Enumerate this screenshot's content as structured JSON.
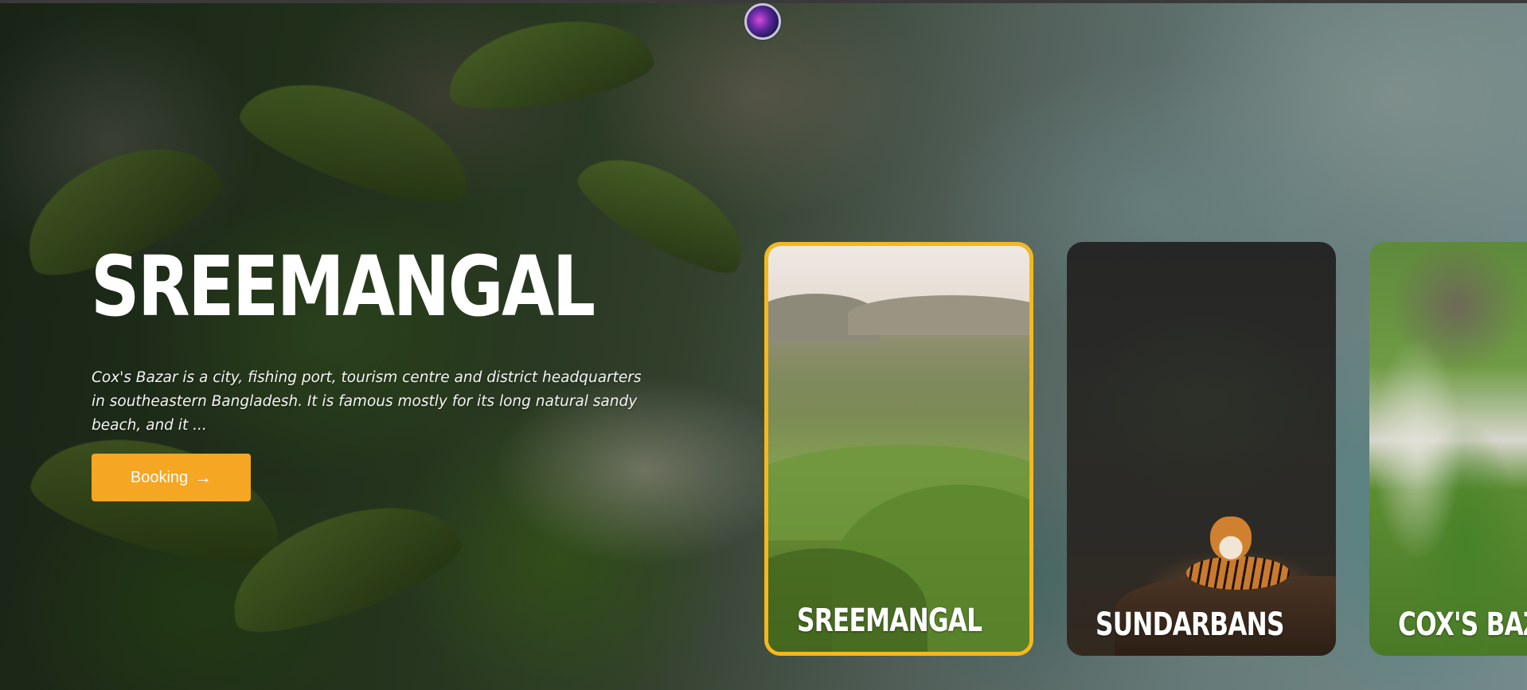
{
  "hero": {
    "title": "SREEMANGAL",
    "description": "Cox's Bazar is a city, fishing port, tourism centre and district headquarters in southeastern Bangladesh. It is famous mostly for its long natural sandy beach, and it ...",
    "booking_label": "Booking",
    "booking_icon": "arrow-right-icon"
  },
  "cards": [
    {
      "label": "SREEMANGAL",
      "active": true
    },
    {
      "label": "SUNDARBANS",
      "active": false
    },
    {
      "label": "COX'S BAZAR",
      "active": false
    }
  ],
  "colors": {
    "accent": "#f5a623",
    "active_border": "#f5b81c",
    "text": "#ffffff"
  }
}
